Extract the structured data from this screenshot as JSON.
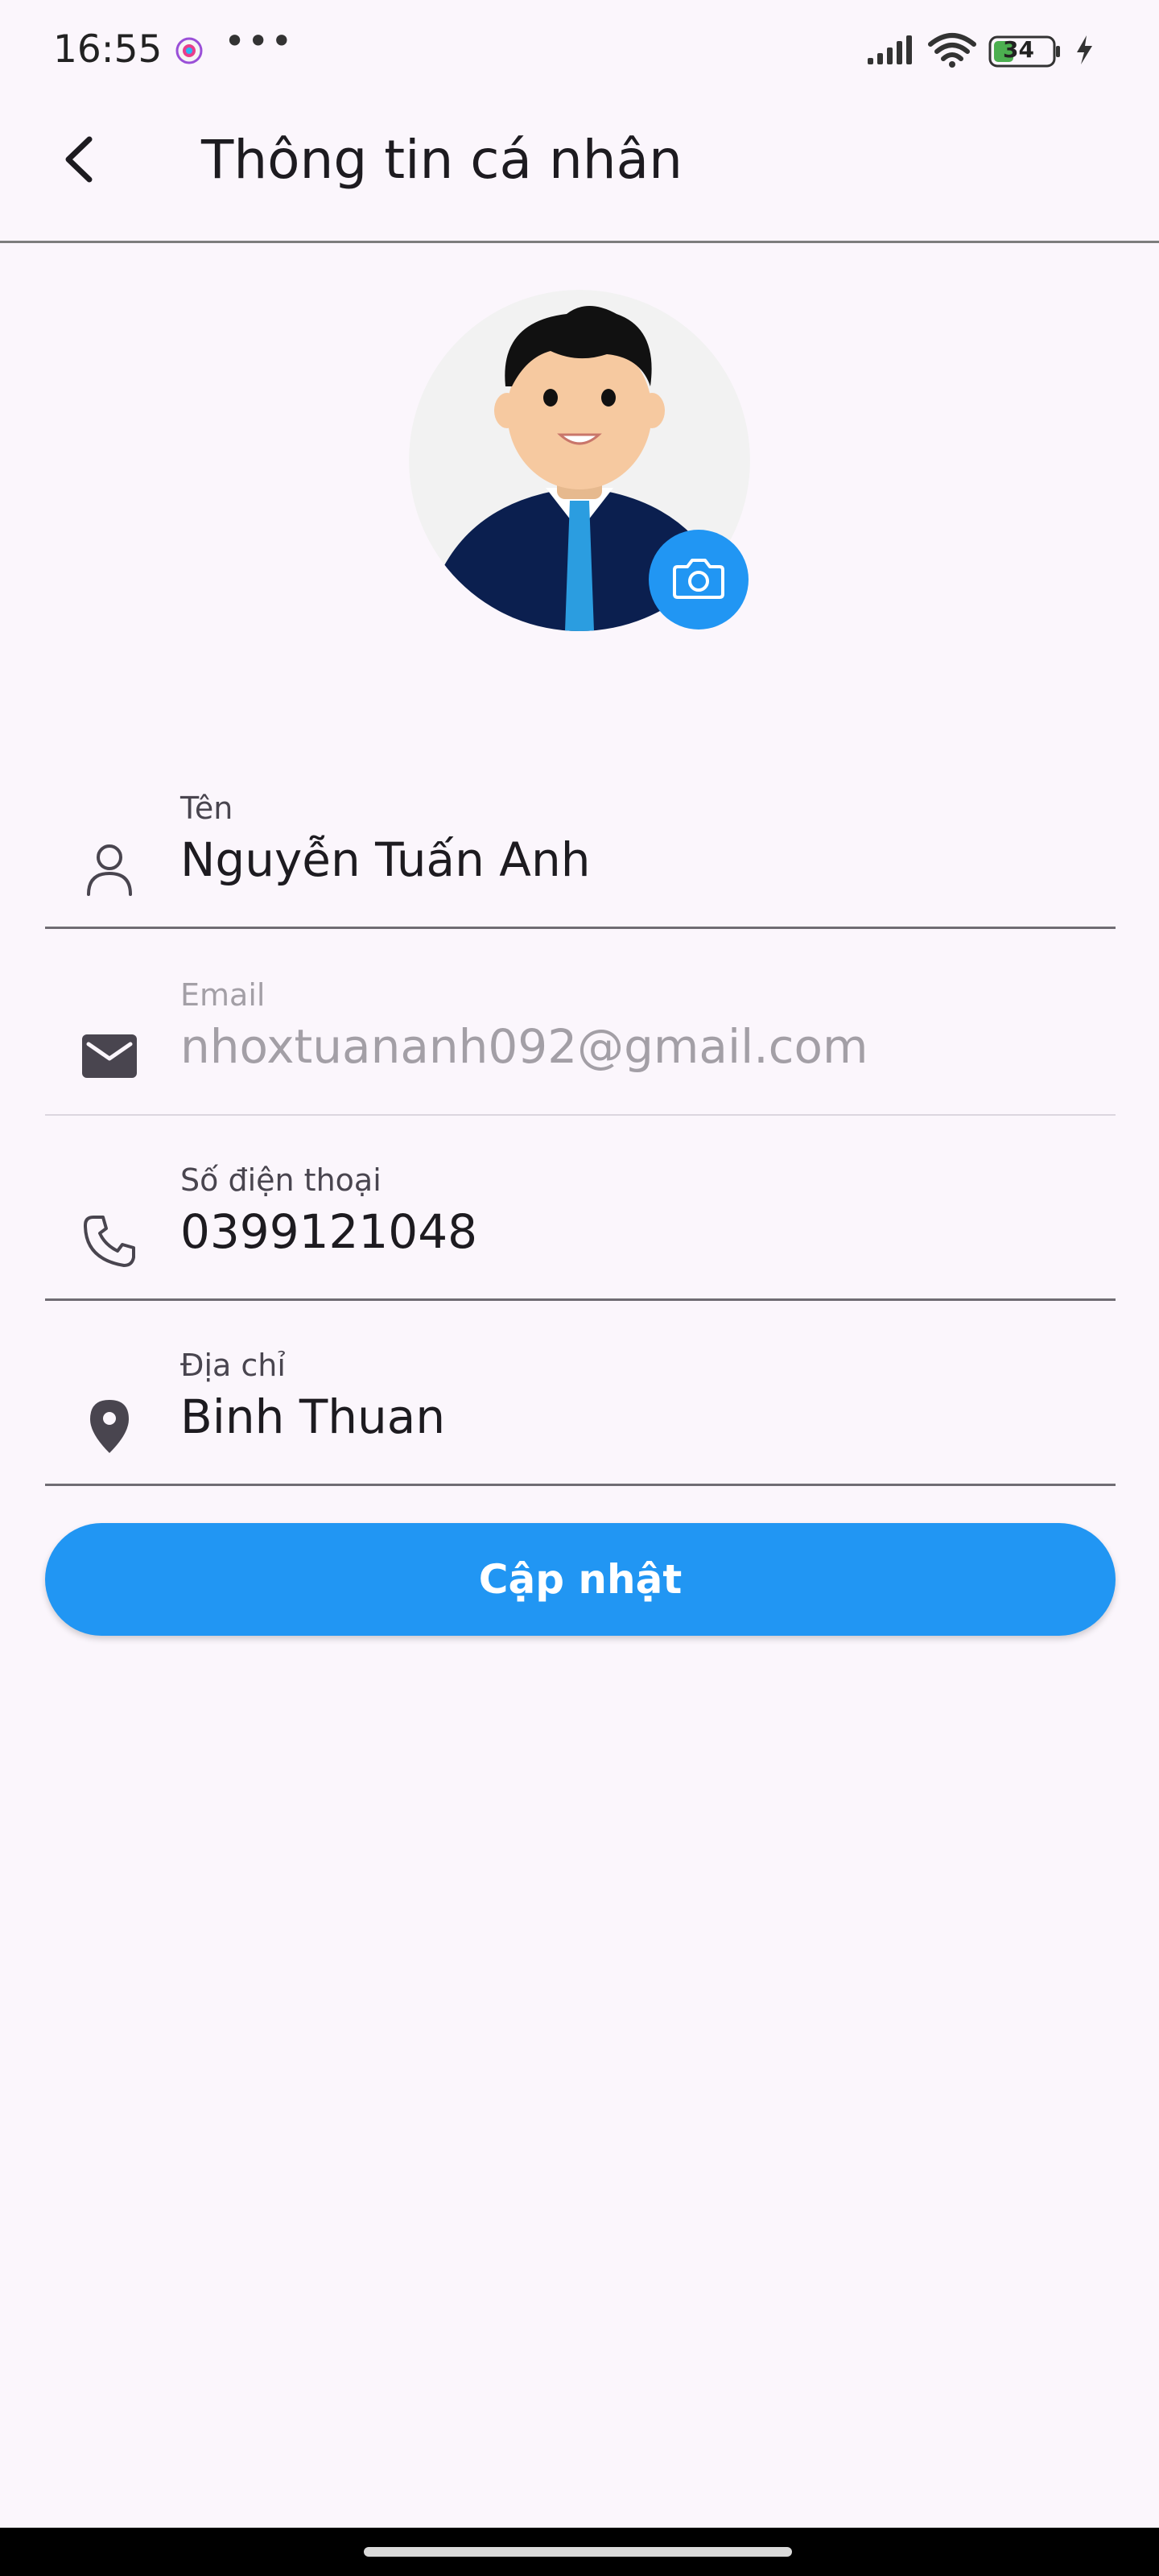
{
  "status_bar": {
    "time": "16:55",
    "more": "•••",
    "battery_level": "34"
  },
  "app_bar": {
    "title": "Thông tin cá nhân",
    "back_icon": "chevron-left-icon"
  },
  "avatar": {
    "image": "man-in-suit-avatar",
    "camera_icon": "camera-icon"
  },
  "form": {
    "fields": [
      {
        "label": "Tên",
        "value": "Nguyễn Tuấn Anh",
        "icon": "person-icon",
        "enabled": true
      },
      {
        "label": "Email",
        "value": "nhoxtuananh092@gmail.com",
        "icon": "mail-icon",
        "enabled": false
      },
      {
        "label": "Số điện thoại",
        "value": "0399121048",
        "icon": "phone-icon",
        "enabled": true
      },
      {
        "label": "Địa chỉ",
        "value": "Binh Thuan",
        "icon": "location-pin-icon",
        "enabled": true
      }
    ],
    "submit_label": "Cập nhật"
  },
  "colors": {
    "primary": "#2196f3",
    "background": "#fbf6fc",
    "text": "#1d1b20",
    "disabled_text": "#a39fa6"
  }
}
